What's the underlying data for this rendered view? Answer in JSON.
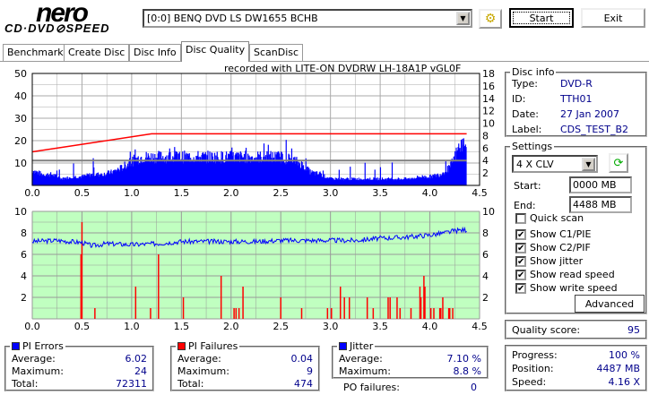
{
  "logo": {
    "brand": "nero",
    "product": "CD·DVD SPEED"
  },
  "toolbar": {
    "drive": "[0:0]  BENQ DVD LS DW1655 BCHB",
    "start_label": "Start",
    "exit_label": "Exit",
    "drive_icon": "drive-config-icon"
  },
  "tabs": [
    {
      "label": "Benchmark"
    },
    {
      "label": "Create Disc"
    },
    {
      "label": "Disc Info"
    },
    {
      "label": "Disc Quality",
      "active": true
    },
    {
      "label": "ScanDisc"
    }
  ],
  "recorded_with": "recorded with LITE-ON DVDRW LH-18A1P    vGL0F",
  "disc_info": {
    "title": "Disc info",
    "rows": [
      {
        "label": "Type:",
        "value": "DVD-R"
      },
      {
        "label": "ID:",
        "value": "TTH01"
      },
      {
        "label": "Date:",
        "value": "27 Jan 2007"
      },
      {
        "label": "Label:",
        "value": "CDS_TEST_B2"
      }
    ]
  },
  "settings": {
    "title": "Settings",
    "speed": "4 X CLV",
    "start_label": "Start:",
    "start_value": "0000 MB",
    "end_label": "End:",
    "end_value": "4488 MB",
    "checkboxes": [
      {
        "label": "Quick scan",
        "checked": false
      },
      {
        "label": "Show C1/PIE",
        "checked": true
      },
      {
        "label": "Show C2/PIF",
        "checked": true
      },
      {
        "label": "Show jitter",
        "checked": true
      },
      {
        "label": "Show read speed",
        "checked": true
      },
      {
        "label": "Show write speed",
        "checked": true
      }
    ],
    "advanced_label": "Advanced"
  },
  "quality": {
    "label": "Quality score:",
    "value": "95"
  },
  "progress": {
    "rows": [
      {
        "label": "Progress:",
        "value": "100 %"
      },
      {
        "label": "Position:",
        "value": "4487 MB"
      },
      {
        "label": "Speed:",
        "value": "4.16 X"
      }
    ]
  },
  "pi_errors": {
    "title": "PI Errors",
    "color": "#0000ff",
    "rows": [
      {
        "label": "Average:",
        "value": "6.02"
      },
      {
        "label": "Maximum:",
        "value": "24"
      },
      {
        "label": "Total:",
        "value": "72311"
      }
    ]
  },
  "pi_failures": {
    "title": "PI Failures",
    "color": "#ff0000",
    "rows": [
      {
        "label": "Average:",
        "value": "0.04"
      },
      {
        "label": "Maximum:",
        "value": "9"
      },
      {
        "label": "Total:",
        "value": "474"
      }
    ]
  },
  "jitter": {
    "title": "Jitter",
    "color": "#0000ff",
    "rows": [
      {
        "label": "Average:",
        "value": "7.10 %"
      },
      {
        "label": "Maximum:",
        "value": "8.8 %"
      }
    ],
    "po_label": "PO failures:",
    "po_value": "0"
  },
  "chart_data": [
    {
      "type": "bar",
      "name": "PI Errors / speed",
      "xlim": [
        0,
        4.5
      ],
      "ylim_left": [
        0,
        50
      ],
      "ylim_right": [
        0,
        18
      ],
      "x_ticks": [
        "0.0",
        "0.5",
        "1.0",
        "1.5",
        "2.0",
        "2.5",
        "3.0",
        "3.5",
        "4.0",
        "4.5"
      ],
      "y_ticks_left": [
        "50",
        "40",
        "30",
        "20",
        "10"
      ],
      "y_ticks_right": [
        "18",
        "16",
        "14",
        "12",
        "10",
        "8",
        "6",
        "4",
        "2"
      ],
      "pie_profile": {
        "x": [
          0,
          0.1,
          0.2,
          0.3,
          0.4,
          0.5,
          0.6,
          0.7,
          0.8,
          0.9,
          1.0,
          1.1,
          1.2,
          1.3,
          1.4,
          1.5,
          1.6,
          1.7,
          1.8,
          1.9,
          2.0,
          2.1,
          2.2,
          2.3,
          2.4,
          2.5,
          2.6,
          2.7,
          2.8,
          2.9,
          3.0,
          3.1,
          3.2,
          3.3,
          3.4,
          3.5,
          3.6,
          3.7,
          3.8,
          3.9,
          4.0,
          4.1,
          4.2,
          4.3,
          4.37
        ],
        "y": [
          7,
          5,
          5,
          3,
          4,
          4,
          5,
          5,
          6,
          8,
          11,
          13,
          13,
          13,
          13,
          13,
          13,
          13,
          13,
          13,
          13,
          13,
          13,
          13,
          13,
          13,
          12,
          10,
          6,
          5,
          3,
          3,
          3,
          3,
          3,
          3,
          3,
          3,
          3,
          4,
          4,
          5,
          8,
          18,
          20
        ]
      },
      "read_speed": {
        "x": [
          0,
          1.2,
          4.37
        ],
        "y": [
          5.4,
          8.3,
          8.3
        ],
        "color": "#ff0000"
      },
      "write_speed": {
        "x": [
          0,
          4.37
        ],
        "y": [
          4,
          4
        ],
        "color": "#808080"
      },
      "bar_color": "#0000ff"
    },
    {
      "type": "bar",
      "name": "PI Failures / jitter",
      "xlim": [
        0,
        4.5
      ],
      "ylim": [
        0,
        10
      ],
      "x_ticks": [
        "0.0",
        "0.5",
        "1.0",
        "1.5",
        "2.0",
        "2.5",
        "3.0",
        "3.5",
        "4.0",
        "4.5"
      ],
      "y_ticks_left": [
        "10",
        "8",
        "6",
        "4",
        "2"
      ],
      "y_ticks_right": [
        "10",
        "8",
        "6",
        "4",
        "2"
      ],
      "pif": {
        "x": [
          0.49,
          0.5,
          0.63,
          1.04,
          1.19,
          1.27,
          1.52,
          1.9,
          2.03,
          2.05,
          2.08,
          2.12,
          2.5,
          2.71,
          2.97,
          3.01,
          3.1,
          3.14,
          3.19,
          3.37,
          3.43,
          3.58,
          3.6,
          3.67,
          3.7,
          3.81,
          3.9,
          3.91,
          3.94,
          3.95,
          4.01,
          4.04,
          4.1,
          4.11,
          4.13,
          4.19,
          4.2,
          4.23
        ],
        "y": [
          6,
          9,
          1,
          3,
          1,
          6,
          2,
          4,
          1,
          1,
          1,
          3,
          2,
          1,
          1,
          1,
          3,
          2,
          2,
          2,
          1,
          2,
          2,
          2,
          1,
          1,
          3,
          2,
          4,
          3,
          1,
          1,
          1,
          1,
          2,
          1,
          1,
          1
        ]
      },
      "jitter": {
        "x": [
          0,
          0.25,
          0.5,
          0.6,
          0.75,
          1.0,
          1.25,
          1.5,
          1.75,
          2.0,
          2.25,
          2.5,
          2.75,
          3.0,
          3.25,
          3.5,
          3.75,
          4.0,
          4.15,
          4.25,
          4.37
        ],
        "y": [
          7.2,
          7.3,
          7.1,
          6.8,
          7.0,
          6.9,
          7.0,
          7.2,
          7.2,
          7.2,
          7.2,
          7.3,
          7.3,
          7.3,
          7.3,
          7.5,
          7.6,
          7.8,
          8.0,
          8.2,
          8.3
        ]
      },
      "bg_color": "#c0ffc0",
      "bar_color": "#ff0000",
      "line_color": "#0000ff"
    }
  ]
}
